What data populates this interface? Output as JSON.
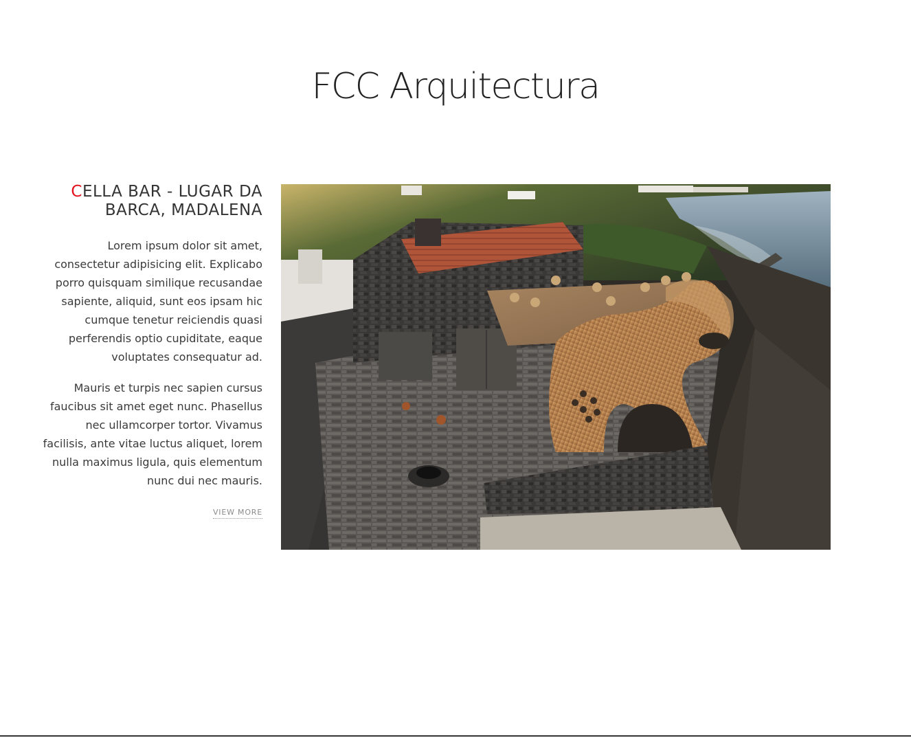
{
  "header": {
    "site_title": "FCC Arquitectura"
  },
  "project": {
    "title_first_letter": "C",
    "title_rest_line1": "ELLA BAR - LUGAR DA",
    "title_line2": "BARCA, MADALENA",
    "paragraph_1": "Lorem ipsum dolor sit amet, consectetur adipisicing elit. Explicabo porro quisquam similique recusandae sapiente, aliquid, sunt eos ipsam hic cumque tenetur reiciendis quasi perferendis optio cupiditate, eaque voluptates consequatur ad.",
    "paragraph_2": "Mauris et turpis nec sapien cursus faucibus sit amet eget nunc. Phasellus nec ullamcorper tortor. Vivamus facilisis, ante vitae luctus aliquet, lorem nulla maximus ligula, quis elementum nunc dui nec mauris.",
    "view_more_label": "VIEW MORE"
  },
  "colors": {
    "accent": "#e3101b",
    "text": "#333333",
    "link": "#8a8a8a"
  },
  "photo": {
    "subject": "aerial-photo-of-bar-building"
  }
}
